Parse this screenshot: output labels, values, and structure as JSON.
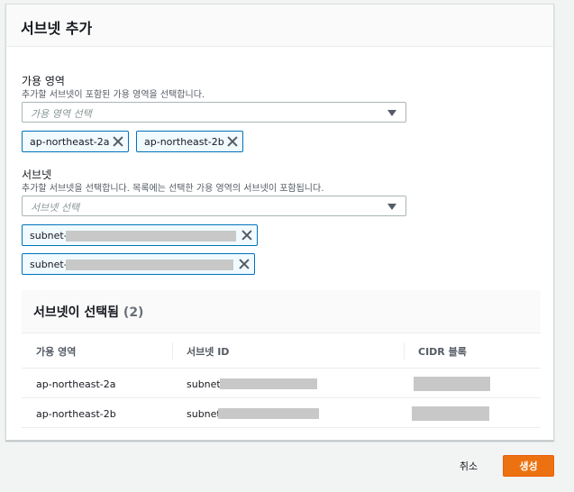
{
  "panel": {
    "title": "서브넷 추가"
  },
  "availability_zone": {
    "label": "가용 영역",
    "description": "추가할 서브넷이 포함된 가용 영역을 선택합니다.",
    "placeholder": "가용 영역 선택",
    "tokens": [
      "ap-northeast-2a",
      "ap-northeast-2b"
    ]
  },
  "subnet": {
    "label": "서브넷",
    "description": "추가할 서브넷을 선택합니다. 목록에는 선택한 가용 영역의 서브넷이 포함됩니다.",
    "placeholder": "서브넷 선택",
    "tokens": [
      "subnet-",
      "subnet-"
    ]
  },
  "selected": {
    "title": "서브넷이 선택됨",
    "count": "(2)",
    "columns": [
      "가용 영역",
      "서브넷 ID",
      "CIDR 블록"
    ],
    "rows": [
      {
        "az": "ap-northeast-2a",
        "subnet_id": "subnet-"
      },
      {
        "az": "ap-northeast-2b",
        "subnet_id": "subnet-"
      }
    ]
  },
  "actions": {
    "cancel_label": "취소",
    "create_label": "생성"
  },
  "colors": {
    "accent": "#ec7211",
    "token_border": "#0073bb",
    "token_bg": "#f1faff"
  },
  "icons": {
    "dropdown": "caret-down-icon",
    "remove": "close-icon"
  }
}
